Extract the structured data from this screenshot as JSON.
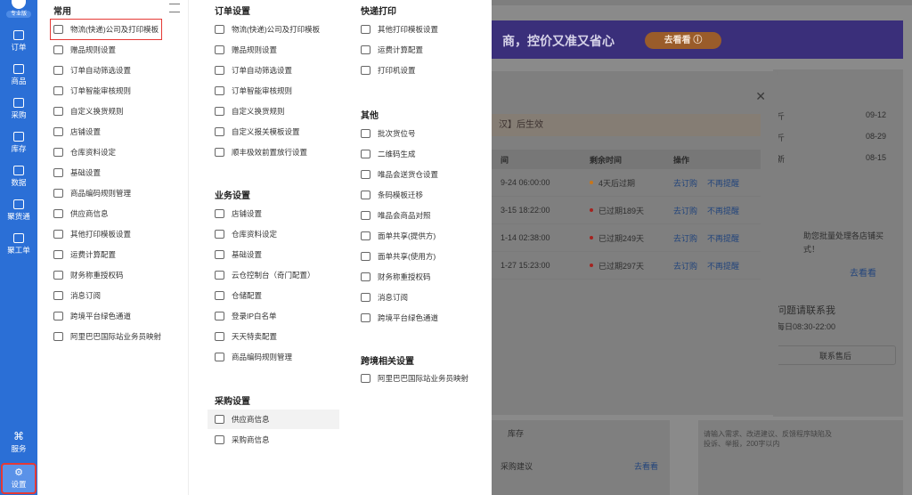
{
  "rail": {
    "badge": "专业版",
    "items": [
      {
        "label": "订单",
        "icon": "order-icon"
      },
      {
        "label": "商品",
        "icon": "goods-icon"
      },
      {
        "label": "采购",
        "icon": "purchase-icon"
      },
      {
        "label": "库存",
        "icon": "stock-icon"
      },
      {
        "label": "数据",
        "icon": "chart-icon"
      },
      {
        "label": "聚货通",
        "icon": "circle-icon"
      },
      {
        "label": "聚工单",
        "icon": "ticket-icon"
      }
    ],
    "service": "服务",
    "settings": "设置"
  },
  "col1": {
    "title": "常用",
    "items": [
      "物流(快递)公司及打印模板",
      "赠品规则设置",
      "订单自动筛选设置",
      "订单智能审核规则",
      "自定义换货规则",
      "店铺设置",
      "仓库资料设定",
      "基础设置",
      "商品编码规则管理",
      "供应商信息",
      "其他打印模板设置",
      "运费计算配置",
      "财务称重授权码",
      "消息订阅",
      "跨境平台绿色通道",
      "阿里巴巴国际站业务员映射"
    ]
  },
  "order": {
    "title": "订单设置",
    "items": [
      "物流(快递)公司及打印模板",
      "赠品规则设置",
      "订单自动筛选设置",
      "订单智能审核规则",
      "自定义换货规则",
      "自定义报关模板设置",
      "顺丰极效前置放行设置"
    ]
  },
  "business": {
    "title": "业务设置",
    "items": [
      "店铺设置",
      "仓库资料设定",
      "基础设置",
      "云仓控制台（奇门配置）",
      "仓储配置",
      "登录IP白名单",
      "天天特卖配置",
      "商品编码规则管理"
    ]
  },
  "purchase": {
    "title": "采购设置",
    "items": [
      "供应商信息",
      "采购商信息"
    ]
  },
  "express": {
    "title": "快递打印",
    "items": [
      "其他打印模板设置",
      "运费计算配置",
      "打印机设置"
    ]
  },
  "other": {
    "title": "其他",
    "items": [
      "批次货位号",
      "二维码生成",
      "唯品会送货仓设置",
      "条码模板迁移",
      "唯品会商品对照",
      "面单共享(提供方)",
      "面单共享(使用方)",
      "财务称重授权码",
      "消息订阅",
      "跨境平台绿色通道"
    ]
  },
  "crossborder": {
    "title": "跨境相关设置",
    "items": [
      "阿里巴巴国际站业务员映射"
    ]
  },
  "background": {
    "banner_text": "商，控价又准又省心",
    "banner_button": "去看看 ⓘ",
    "modal_notice": "汉】后生效",
    "headers": [
      "间",
      "剩余时间",
      "操作"
    ],
    "rows": [
      {
        "time": "9-24 06:00:00",
        "remain": "4天后过期",
        "color": "#c8761a",
        "a": "去订购",
        "b": "不再提醒"
      },
      {
        "time": "3-15 18:22:00",
        "remain": "已过期189天",
        "color": "#a4231f",
        "a": "去订购",
        "b": "不再提醒"
      },
      {
        "time": "1-14 02:38:00",
        "remain": "已过期249天",
        "color": "#a4231f",
        "a": "去订购",
        "b": "不再提醒"
      },
      {
        "time": "1-27 15:23:00",
        "remain": "已过期297天",
        "color": "#a4231f",
        "a": "去订购",
        "b": "不再提醒"
      }
    ],
    "right_items": [
      {
        "t": "斤",
        "d": "09-12"
      },
      {
        "t": "斤",
        "d": "08-29"
      },
      {
        "t": "新",
        "d": "08-15"
      }
    ],
    "promo1": "助您批量处理各店铺买",
    "promo2": "式！",
    "promo_link": "去看看",
    "contact_title": "问题请联系我",
    "contact_time": "每日08:30-22:00",
    "contact_button": "联系售后",
    "stock": "库存",
    "purchase_suggest": "采购建议",
    "goto1": "去看看",
    "feedback": "请输入需求、改进建议、反馈程序缺陷及投诉、举报，200字以内"
  }
}
